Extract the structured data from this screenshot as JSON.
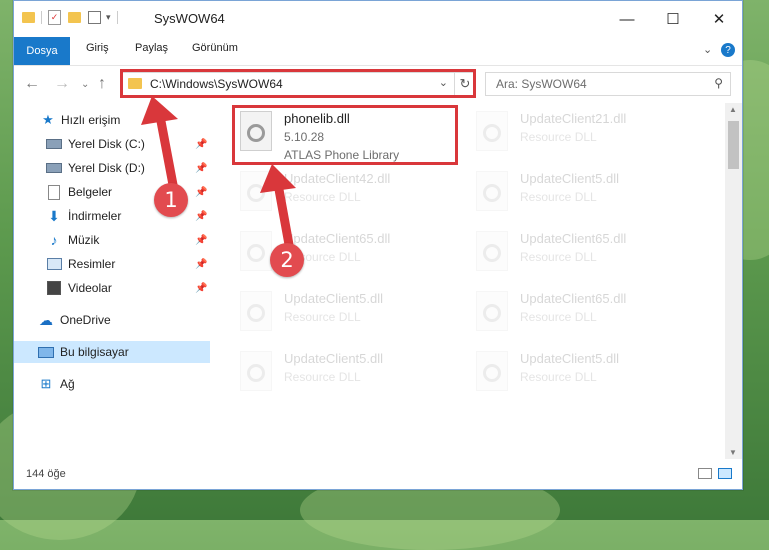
{
  "window": {
    "title": "SysWOW64"
  },
  "ribbon": {
    "tabs": [
      "Dosya",
      "Giriş",
      "Paylaş",
      "Görünüm"
    ]
  },
  "address": {
    "path": "C:\\Windows\\SysWOW64",
    "search_placeholder": "Ara: SysWOW64"
  },
  "nav": {
    "quick_access": "Hızlı erişim",
    "items": [
      {
        "label": "Yerel Disk (C:)",
        "icon": "drive-icon"
      },
      {
        "label": "Yerel Disk (D:)",
        "icon": "drive-icon"
      },
      {
        "label": "Belgeler",
        "icon": "documents-icon"
      },
      {
        "label": "İndirmeler",
        "icon": "downloads-icon"
      },
      {
        "label": "Müzik",
        "icon": "music-icon"
      },
      {
        "label": "Resimler",
        "icon": "pictures-icon"
      },
      {
        "label": "Videolar",
        "icon": "videos-icon"
      }
    ],
    "onedrive": "OneDrive",
    "this_pc": "Bu bilgisayar",
    "network": "Ağ"
  },
  "files": {
    "highlighted": {
      "name": "phonelib.dll",
      "version": "5.10.28",
      "description": "ATLAS Phone Library"
    },
    "faded": [
      {
        "name": "UpdateClient21.dll",
        "sub": "Resource DLL"
      },
      {
        "name": "UpdateClient42.dll",
        "sub": "Resource DLL"
      },
      {
        "name": "UpdateClient5.dll",
        "sub": "Resource DLL"
      },
      {
        "name": "UpdateClient65.dll",
        "sub": "Resource DLL"
      },
      {
        "name": "UpdateClient65.dll",
        "sub": "Resource DLL"
      },
      {
        "name": "UpdateClient5.dll",
        "sub": "Resource DLL"
      },
      {
        "name": "UpdateClient65.dll",
        "sub": "Resource DLL"
      },
      {
        "name": "UpdateClient5.dll",
        "sub": "Resource DLL"
      },
      {
        "name": "UpdateClient5.dll",
        "sub": "Resource DLL"
      }
    ]
  },
  "status": {
    "count": "144 öğe"
  },
  "annotations": {
    "badge1": "1",
    "badge2": "2"
  },
  "colors": {
    "accent": "#1979ca",
    "highlight": "#d9373b"
  }
}
